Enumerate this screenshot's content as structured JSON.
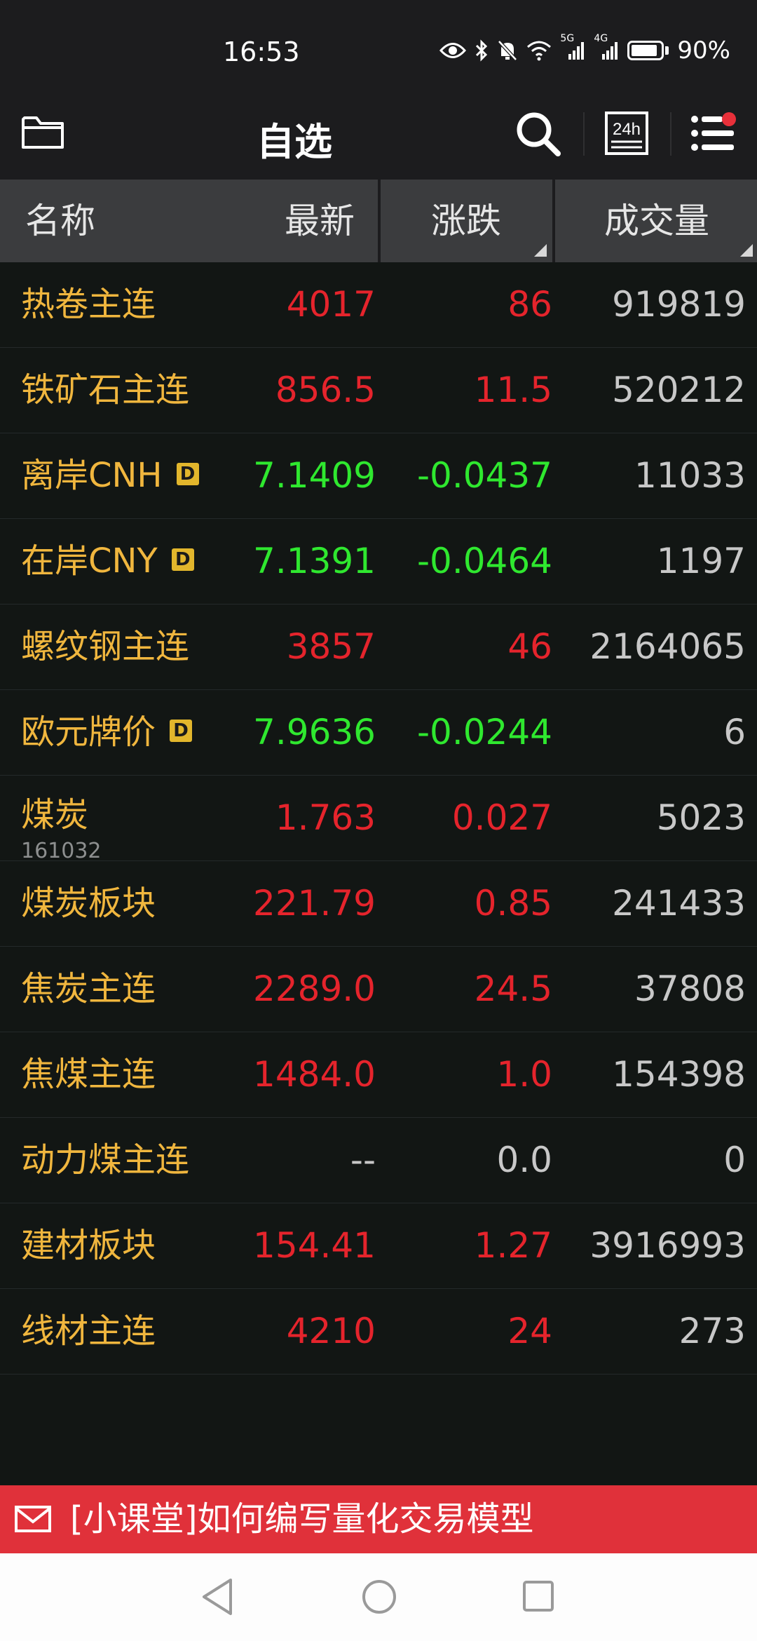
{
  "status_bar": {
    "time": "16:53",
    "battery": "90%",
    "signal1_label": "5G",
    "signal2_label": "4G"
  },
  "nav": {
    "title": "自选",
    "h24_label": "24h"
  },
  "table_header": {
    "name": "名称",
    "latest": "最新",
    "change": "涨跌",
    "volume": "成交量"
  },
  "rows": [
    {
      "name": "热卷主连",
      "code": "",
      "badge": "",
      "latest": "4017",
      "change": "86",
      "volume": "919819",
      "trend": "up"
    },
    {
      "name": "铁矿石主连",
      "code": "",
      "badge": "",
      "latest": "856.5",
      "change": "11.5",
      "volume": "520212",
      "trend": "up"
    },
    {
      "name": "离岸CNH",
      "code": "",
      "badge": "D",
      "latest": "7.1409",
      "change": "-0.0437",
      "volume": "11033",
      "trend": "down"
    },
    {
      "name": "在岸CNY",
      "code": "",
      "badge": "D",
      "latest": "7.1391",
      "change": "-0.0464",
      "volume": "1197",
      "trend": "down"
    },
    {
      "name": "螺纹钢主连",
      "code": "",
      "badge": "",
      "latest": "3857",
      "change": "46",
      "volume": "2164065",
      "trend": "up"
    },
    {
      "name": "欧元牌价",
      "code": "",
      "badge": "D",
      "latest": "7.9636",
      "change": "-0.0244",
      "volume": "6",
      "trend": "down"
    },
    {
      "name": "煤炭",
      "code": "161032",
      "badge": "",
      "latest": "1.763",
      "change": "0.027",
      "volume": "5023",
      "trend": "up"
    },
    {
      "name": "煤炭板块",
      "code": "",
      "badge": "",
      "latest": "221.79",
      "change": "0.85",
      "volume": "241433",
      "trend": "up"
    },
    {
      "name": "焦炭主连",
      "code": "",
      "badge": "",
      "latest": "2289.0",
      "change": "24.5",
      "volume": "37808",
      "trend": "up"
    },
    {
      "name": "焦煤主连",
      "code": "",
      "badge": "",
      "latest": "1484.0",
      "change": "1.0",
      "volume": "154398",
      "trend": "up"
    },
    {
      "name": "动力煤主连",
      "code": "",
      "badge": "",
      "latest": "--",
      "change": "0.0",
      "volume": "0",
      "trend": "flat"
    },
    {
      "name": "建材板块",
      "code": "",
      "badge": "",
      "latest": "154.41",
      "change": "1.27",
      "volume": "3916993",
      "trend": "up"
    },
    {
      "name": "线材主连",
      "code": "",
      "badge": "",
      "latest": "4210",
      "change": "24",
      "volume": "273",
      "trend": "up"
    }
  ],
  "banner": {
    "text": "[小课堂]如何编写量化交易模型"
  },
  "colors": {
    "up": "#e5242c",
    "down": "#2fe82f",
    "name": "#f0b63e",
    "banner": "#e0313a"
  }
}
